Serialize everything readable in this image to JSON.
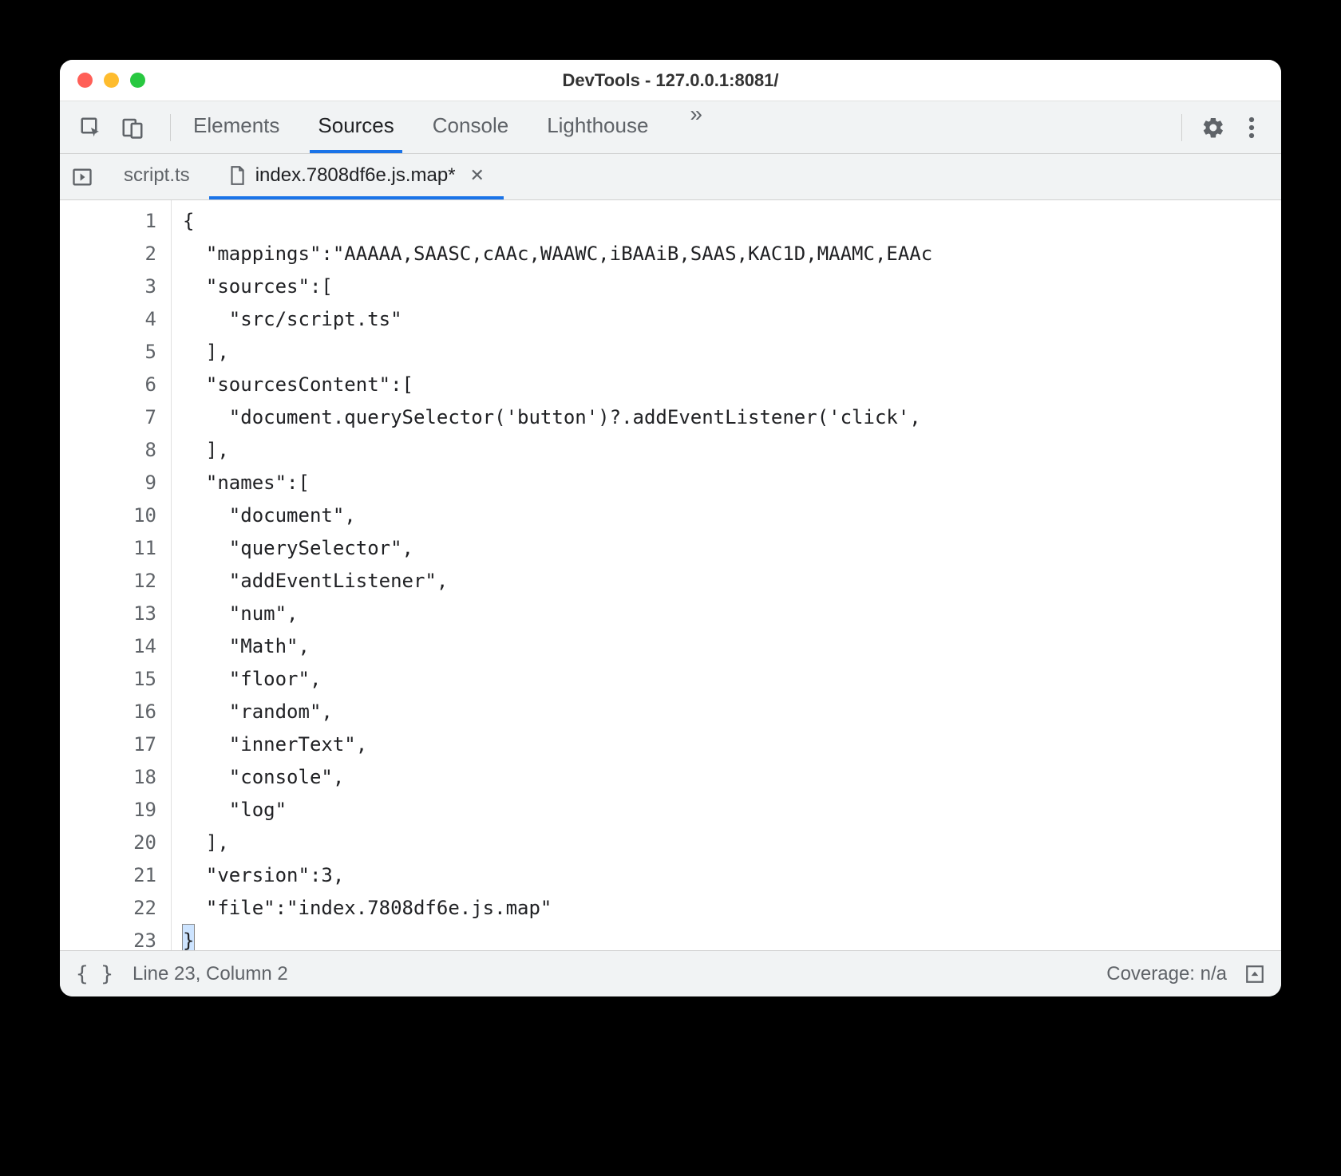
{
  "window": {
    "title": "DevTools - 127.0.0.1:8081/"
  },
  "toolbar": {
    "tabs": [
      "Elements",
      "Sources",
      "Console",
      "Lighthouse"
    ],
    "active_tab_index": 1
  },
  "filetabs": {
    "items": [
      {
        "label": "script.ts",
        "icon": null,
        "active": false,
        "closeable": false
      },
      {
        "label": "index.7808df6e.js.map*",
        "icon": "file",
        "active": true,
        "closeable": true
      }
    ]
  },
  "editor": {
    "lines": [
      "{",
      "  \"mappings\":\"AAAAA,SAASC,cAAc,WAAWC,iBAAiB,SAAS,KAC1D,MAAMC,EAAc",
      "  \"sources\":[",
      "    \"src/script.ts\"",
      "  ],",
      "  \"sourcesContent\":[",
      "    \"document.querySelector('button')?.addEventListener('click',",
      "  ],",
      "  \"names\":[",
      "    \"document\",",
      "    \"querySelector\",",
      "    \"addEventListener\",",
      "    \"num\",",
      "    \"Math\",",
      "    \"floor\",",
      "    \"random\",",
      "    \"innerText\",",
      "    \"console\",",
      "    \"log\"",
      "  ],",
      "  \"version\":3,",
      "  \"file\":\"index.7808df6e.js.map\"",
      "}"
    ],
    "cursor_line": 23
  },
  "statusbar": {
    "position": "Line 23, Column 2",
    "coverage": "Coverage: n/a"
  }
}
